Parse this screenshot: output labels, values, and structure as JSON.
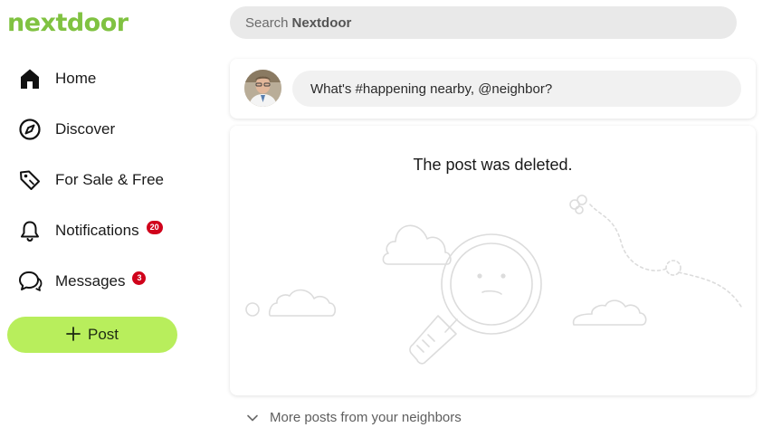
{
  "brand": {
    "logo": "nextdoor",
    "accent": "#80c241",
    "button_color": "#b8ee5c"
  },
  "sidebar": {
    "items": [
      {
        "label": "Home",
        "icon": "home-icon"
      },
      {
        "label": "Discover",
        "icon": "compass-icon"
      },
      {
        "label": "For Sale & Free",
        "icon": "tag-icon"
      },
      {
        "label": "Notifications",
        "icon": "bell-icon",
        "badge": "20"
      },
      {
        "label": "Messages",
        "icon": "chat-icon",
        "badge": "3"
      }
    ],
    "post_button": {
      "label": "Post",
      "icon": "plus-icon"
    }
  },
  "search": {
    "prefix": "Search",
    "brand": "Nextdoor"
  },
  "composer": {
    "placeholder": "What's #happening nearby, @neighbor?"
  },
  "post_card": {
    "message": "The post was deleted.",
    "illustration": "magnifier-sad-face-illustration"
  },
  "more_posts": {
    "label": "More posts from your neighbors",
    "icon": "chevron-down-icon"
  },
  "colors": {
    "badge": "#d0021b"
  }
}
